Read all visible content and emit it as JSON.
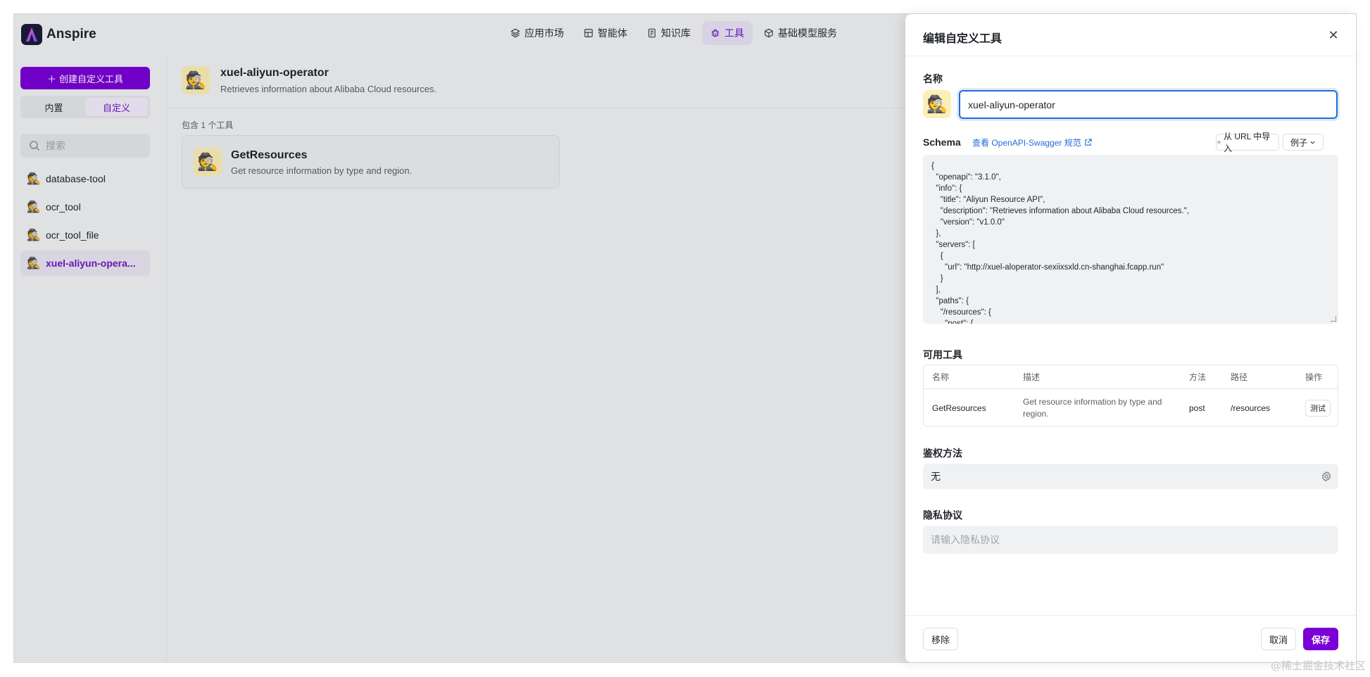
{
  "app": {
    "name": "Anspire"
  },
  "nav": [
    {
      "label": "应用市场",
      "icon": "layers-icon",
      "active": false
    },
    {
      "label": "智能体",
      "icon": "grid-icon",
      "active": false
    },
    {
      "label": "知识库",
      "icon": "book-icon",
      "active": false
    },
    {
      "label": "工具",
      "icon": "bug-icon",
      "active": true
    },
    {
      "label": "基础模型服务",
      "icon": "cube-icon",
      "active": false
    }
  ],
  "sidebar": {
    "create_label": "创建自定义工具",
    "segments": [
      {
        "label": "内置",
        "active": false
      },
      {
        "label": "自定义",
        "active": true
      }
    ],
    "search_placeholder": "搜索",
    "tools": [
      {
        "label": "database-tool",
        "active": false
      },
      {
        "label": "ocr_tool",
        "active": false
      },
      {
        "label": "ocr_tool_file",
        "active": false
      },
      {
        "label": "xuel-aliyun-opera...",
        "active": true
      }
    ]
  },
  "main": {
    "tool_title": "xuel-aliyun-operator",
    "tool_desc": "Retrieves information about Alibaba Cloud resources.",
    "count_label": "包含 1 个工具",
    "card": {
      "title": "GetResources",
      "desc": "Get resource information by type and region."
    }
  },
  "drawer": {
    "title": "编辑自定义工具",
    "name_label": "名称",
    "name_value": "xuel-aliyun-operator",
    "schema_label": "Schema",
    "swagger_link": "查看 OpenAPI-Swagger 规范",
    "import_url_label": "从 URL 中导入",
    "example_label": "例子",
    "schema_text": "{\n  \"openapi\": \"3.1.0\",\n  \"info\": {\n    \"title\": \"Aliyun Resource API\",\n    \"description\": \"Retrieves information about Alibaba Cloud resources.\",\n    \"version\": \"v1.0.0\"\n  },\n  \"servers\": [\n    {\n      \"url\": \"http://xuel-aloperator-sexiixsxld.cn-shanghai.fcapp.run\"\n    }\n  ],\n  \"paths\": {\n    \"/resources\": {\n      \"post\": {",
    "available_tools_label": "可用工具",
    "table": {
      "headers": [
        "名称",
        "描述",
        "方法",
        "路径",
        "操作"
      ],
      "rows": [
        {
          "name": "GetResources",
          "desc": "Get resource information by type and region.",
          "method": "post",
          "path": "/resources",
          "action": "测试"
        }
      ]
    },
    "auth_label": "鉴权方法",
    "auth_value": "无",
    "privacy_label": "隐私协议",
    "privacy_placeholder": "请输入隐私协议",
    "remove_label": "移除",
    "cancel_label": "取消",
    "save_label": "保存"
  },
  "watermark": "@稀土掘金技术社区",
  "colors": {
    "accent": "#7a00d6",
    "link": "#1f6dd8",
    "avatar_bg": "#fbefb7"
  }
}
